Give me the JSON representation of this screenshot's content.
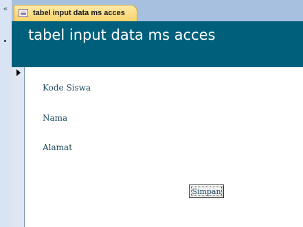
{
  "nav": {
    "collapse_glyph": "«"
  },
  "tab": {
    "icon": "form-icon",
    "label": "tabel input data ms acces"
  },
  "form": {
    "title": "tabel input data ms acces",
    "fields": [
      {
        "label": "Kode Siswa"
      },
      {
        "label": "Nama"
      },
      {
        "label": "Alamat"
      }
    ],
    "save_button_label": "Simpan"
  },
  "colors": {
    "header_bg": "#00607c",
    "tab_bg": "#f9d36d",
    "label_text": "#1c4a5e"
  }
}
